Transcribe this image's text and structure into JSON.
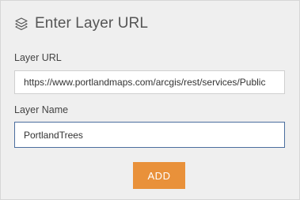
{
  "header": {
    "icon": "layers-icon",
    "title": "Enter Layer URL"
  },
  "layer_url": {
    "label": "Layer URL",
    "value": "https://www.portlandmaps.com/arcgis/rest/services/Public"
  },
  "layer_name": {
    "label": "Layer Name",
    "value": "PortlandTrees"
  },
  "add_button": {
    "label": "ADD"
  },
  "colors": {
    "button": "#e9913a",
    "panel_bg": "#efefef",
    "focus_border": "#4b6e9e"
  }
}
